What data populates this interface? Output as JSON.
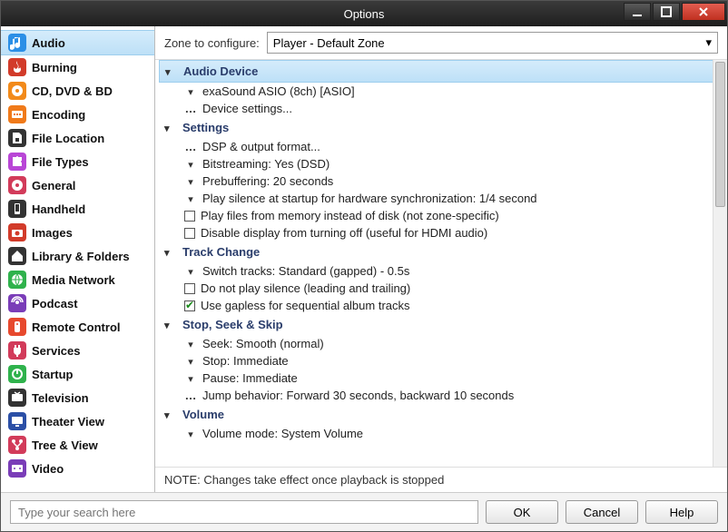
{
  "window": {
    "title": "Options"
  },
  "sidebar": {
    "items": [
      {
        "label": "Audio",
        "icon": "audio",
        "color": "#2b8fe6",
        "selected": true
      },
      {
        "label": "Burning",
        "icon": "burn",
        "color": "#d23b2a"
      },
      {
        "label": "CD, DVD & BD",
        "icon": "disc",
        "color": "#f28a1a"
      },
      {
        "label": "Encoding",
        "icon": "encode",
        "color": "#f07a1a"
      },
      {
        "label": "File Location",
        "icon": "filelock",
        "color": "#333333"
      },
      {
        "label": "File Types",
        "icon": "puzzle",
        "color": "#b946d6"
      },
      {
        "label": "General",
        "icon": "general",
        "color": "#d23b5a"
      },
      {
        "label": "Handheld",
        "icon": "handheld",
        "color": "#333333"
      },
      {
        "label": "Images",
        "icon": "camera",
        "color": "#d23b2a"
      },
      {
        "label": "Library & Folders",
        "icon": "house",
        "color": "#333333"
      },
      {
        "label": "Media Network",
        "icon": "network",
        "color": "#2fb24c"
      },
      {
        "label": "Podcast",
        "icon": "podcast",
        "color": "#7a3db8"
      },
      {
        "label": "Remote Control",
        "icon": "remote",
        "color": "#e7492e"
      },
      {
        "label": "Services",
        "icon": "plug",
        "color": "#d23b5a"
      },
      {
        "label": "Startup",
        "icon": "power",
        "color": "#2fb24c"
      },
      {
        "label": "Television",
        "icon": "tv",
        "color": "#333333"
      },
      {
        "label": "Theater View",
        "icon": "monitor",
        "color": "#2b4fa6"
      },
      {
        "label": "Tree & View",
        "icon": "tree",
        "color": "#d23b5a"
      },
      {
        "label": "Video",
        "icon": "video",
        "color": "#7a3db8"
      }
    ]
  },
  "zone": {
    "label": "Zone to configure:",
    "selected": "Player - Default Zone"
  },
  "sections": [
    {
      "title": "Audio Device",
      "selected": true,
      "expanded": true,
      "rows": [
        {
          "glyph": "chev-down",
          "text": "exaSound ASIO (8ch) [ASIO]"
        },
        {
          "glyph": "dots",
          "text": "Device settings..."
        }
      ]
    },
    {
      "title": "Settings",
      "expanded": true,
      "rows": [
        {
          "glyph": "dots",
          "text": "DSP & output format..."
        },
        {
          "glyph": "chev-down",
          "text": "Bitstreaming: Yes (DSD)"
        },
        {
          "glyph": "chev-down",
          "text": "Prebuffering: 20 seconds"
        },
        {
          "glyph": "chev-down",
          "text": "Play silence at startup for hardware synchronization: 1/4 second"
        },
        {
          "glyph": "box",
          "text": "Play files from memory instead of disk (not zone-specific)"
        },
        {
          "glyph": "box",
          "text": "Disable display from turning off (useful for HDMI audio)"
        }
      ]
    },
    {
      "title": "Track Change",
      "expanded": true,
      "rows": [
        {
          "glyph": "chev-down",
          "text": "Switch tracks: Standard (gapped) - 0.5s"
        },
        {
          "glyph": "box",
          "text": "Do not play silence (leading and trailing)"
        },
        {
          "glyph": "box-checked",
          "text": "Use gapless for sequential album tracks"
        }
      ]
    },
    {
      "title": "Stop, Seek & Skip",
      "expanded": true,
      "rows": [
        {
          "glyph": "chev-down",
          "text": "Seek: Smooth (normal)"
        },
        {
          "glyph": "chev-down",
          "text": "Stop: Immediate"
        },
        {
          "glyph": "chev-down",
          "text": "Pause: Immediate"
        },
        {
          "glyph": "dots",
          "text": "Jump behavior: Forward 30 seconds, backward 10 seconds"
        }
      ]
    },
    {
      "title": "Volume",
      "expanded": true,
      "rows": [
        {
          "glyph": "chev-down",
          "text": "Volume mode: System Volume"
        }
      ]
    }
  ],
  "note": "NOTE: Changes take effect once playback is stopped",
  "footer": {
    "search_placeholder": "Type your search here",
    "ok": "OK",
    "cancel": "Cancel",
    "help": "Help"
  }
}
